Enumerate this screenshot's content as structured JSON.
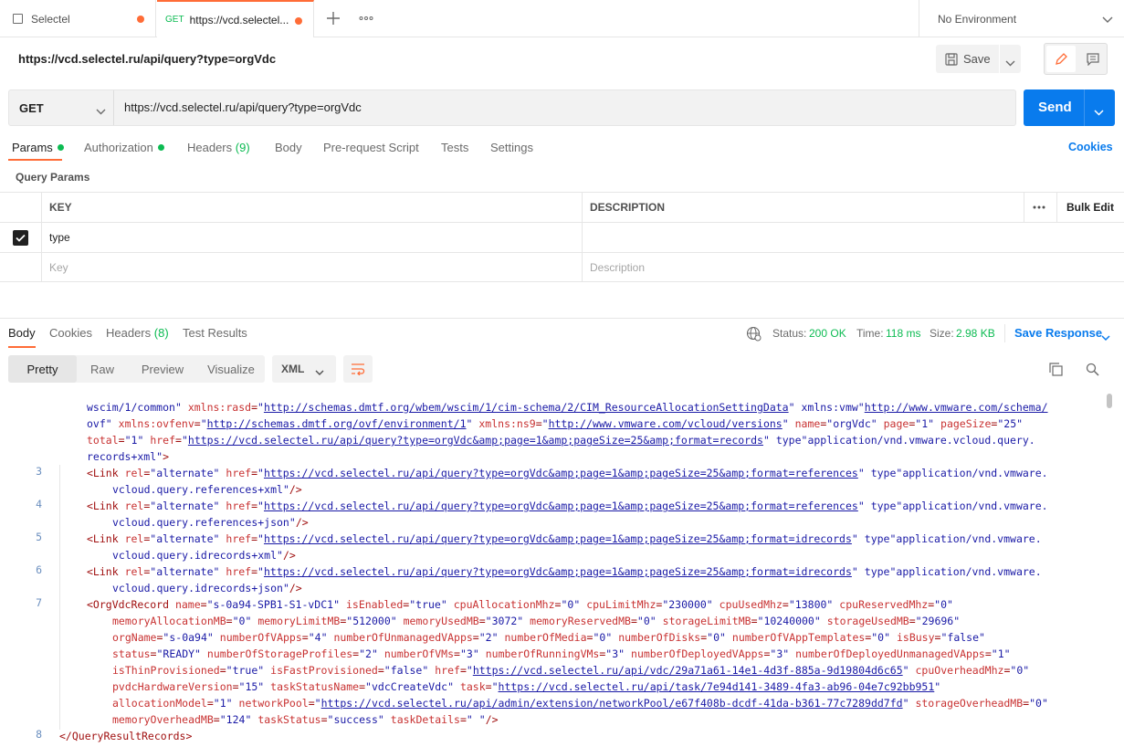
{
  "tabs": [
    {
      "label": "Selectel"
    },
    {
      "method": "GET",
      "label": "https://vcd.selectel..."
    }
  ],
  "environment": "No Environment",
  "request": {
    "title": "https://vcd.selectel.ru/api/query?type=orgVdc",
    "save_label": "Save",
    "method": "GET",
    "url": "https://vcd.selectel.ru/api/query?type=orgVdc",
    "send_label": "Send"
  },
  "request_tabs": {
    "params": "Params",
    "authorization": "Authorization",
    "headers": "Headers",
    "headers_count": "(9)",
    "body": "Body",
    "prerequest": "Pre-request Script",
    "tests": "Tests",
    "settings": "Settings",
    "cookies": "Cookies"
  },
  "query_params": {
    "title": "Query Params",
    "col_key": "KEY",
    "col_description": "DESCRIPTION",
    "bulk_edit": "Bulk Edit",
    "rows": [
      {
        "key": "type",
        "description": ""
      }
    ],
    "key_placeholder": "Key",
    "description_placeholder": "Description"
  },
  "response_tabs": {
    "body": "Body",
    "cookies": "Cookies",
    "headers": "Headers",
    "headers_count": "(8)",
    "test_results": "Test Results"
  },
  "response_status": {
    "status_label": "Status:",
    "status_value": "200 OK",
    "time_label": "Time:",
    "time_value": "118 ms",
    "size_label": "Size:",
    "size_value": "2.98 KB",
    "save_response": "Save Response"
  },
  "view_modes": [
    "Pretty",
    "Raw",
    "Preview",
    "Visualize"
  ],
  "format": "XML",
  "code": {
    "line_numbers": [
      "3",
      "4",
      "5",
      "6",
      "7",
      "8"
    ],
    "lines": [
      "wscim/1/common\" xmlns:rasd=\"http://schemas.dmtf.org/wbem/wscim/1/cim-schema/2/CIM_ResourceAllocationSettingData\" xmlns:vmw=\"http://www.vmware.com/schema/",
      "ovf\" xmlns:ovfenv=\"http://schemas.dmtf.org/ovf/environment/1\" xmlns:ns9=\"http://www.vmware.com/vcloud/versions\" name=\"orgVdc\" page=\"1\" pageSize=\"25\"",
      "total=\"1\" href=\"https://vcd.selectel.ru/api/query?type=orgVdc&amp;page=1&amp;pageSize=25&amp;format=records\" type=\"application/vnd.vmware.vcloud.query.",
      "records+xml\">",
      "<Link rel=\"alternate\" href=\"https://vcd.selectel.ru/api/query?type=orgVdc&amp;page=1&amp;pageSize=25&amp;format=references\" type=\"application/vnd.vmware.",
      "vcloud.query.references+xml\"/>",
      "<Link rel=\"alternate\" href=\"https://vcd.selectel.ru/api/query?type=orgVdc&amp;page=1&amp;pageSize=25&amp;format=references\" type=\"application/vnd.vmware.",
      "vcloud.query.references+json\"/>",
      "<Link rel=\"alternate\" href=\"https://vcd.selectel.ru/api/query?type=orgVdc&amp;page=1&amp;pageSize=25&amp;format=idrecords\" type=\"application/vnd.vmware.",
      "vcloud.query.idrecords+xml\"/>",
      "<Link rel=\"alternate\" href=\"https://vcd.selectel.ru/api/query?type=orgVdc&amp;page=1&amp;pageSize=25&amp;format=idrecords\" type=\"application/vnd.vmware.",
      "vcloud.query.idrecords+json\"/>",
      "<OrgVdcRecord name=\"s-0a94-SPB1-S1-vDC1\" isEnabled=\"true\" cpuAllocationMhz=\"0\" cpuLimitMhz=\"230000\" cpuUsedMhz=\"13800\" cpuReservedMhz=\"0\"",
      "memoryAllocationMB=\"0\" memoryLimitMB=\"512000\" memoryUsedMB=\"3072\" memoryReservedMB=\"0\" storageLimitMB=\"10240000\" storageUsedMB=\"29696\"",
      "orgName=\"s-0a94\" numberOfVApps=\"4\" numberOfUnmanagedVApps=\"2\" numberOfMedia=\"0\" numberOfDisks=\"0\" numberOfVAppTemplates=\"0\" isBusy=\"false\"",
      "status=\"READY\" numberOfStorageProfiles=\"2\" numberOfVMs=\"3\" numberOfRunningVMs=\"3\" numberOfDeployedVApps=\"3\" numberOfDeployedUnmanagedVApps=\"1\"",
      "isThinProvisioned=\"true\" isFastProvisioned=\"false\" href=\"https://vcd.selectel.ru/api/vdc/29a71a61-14e1-4d3f-885a-9d19804d6c65\" cpuOverheadMhz=\"0\"",
      "pvdcHardwareVersion=\"15\" taskStatusName=\"vdcCreateVdc\" task=\"https://vcd.selectel.ru/api/task/7e94d141-3489-4fa3-ab96-04e7c92bb951\"",
      "allocationModel=\"1\" networkPool=\"https://vcd.selectel.ru/api/admin/extension/networkPool/e67f408b-dcdf-41da-b361-77c7289dd7fd\" storageOverheadMB=\"0\"",
      "memoryOverheadMB=\"124\" taskStatus=\"success\" taskDetails=\" \"/>",
      "</QueryResultRecords>"
    ]
  }
}
